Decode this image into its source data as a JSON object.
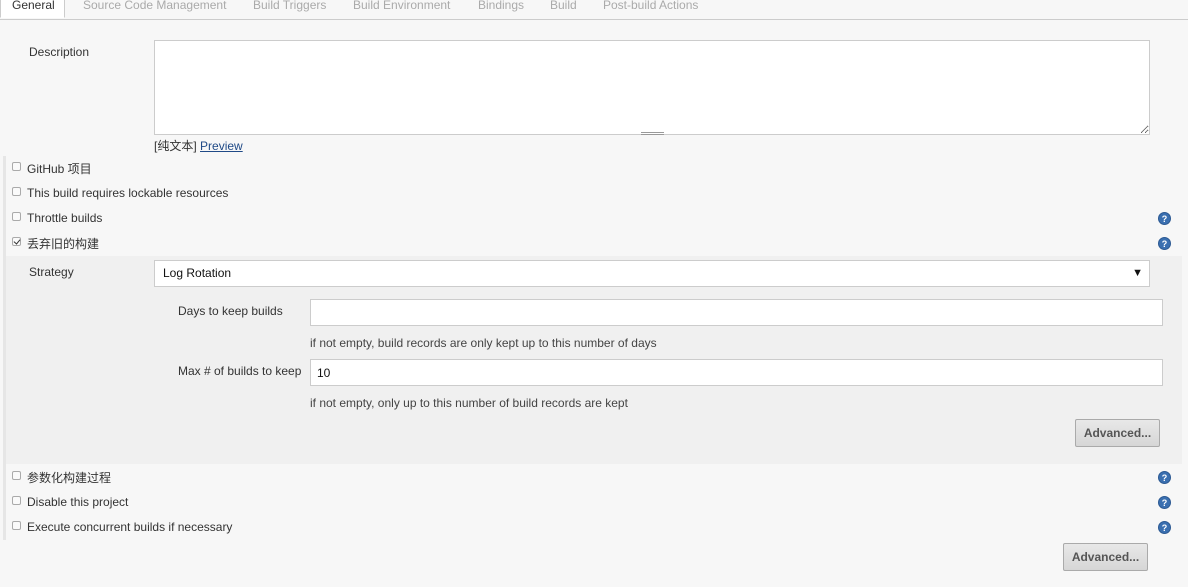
{
  "tabs": [
    {
      "label": "General"
    },
    {
      "label": "Source Code Management"
    },
    {
      "label": "Build Triggers"
    },
    {
      "label": "Build Environment"
    },
    {
      "label": "Bindings"
    },
    {
      "label": "Build"
    },
    {
      "label": "Post-build Actions"
    }
  ],
  "description": {
    "label": "Description",
    "value": "",
    "format_label": "[纯文本]",
    "preview_link": "Preview"
  },
  "options_top": [
    {
      "label": "GitHub 项目",
      "checked": false
    },
    {
      "label": "This build requires lockable resources",
      "checked": false
    },
    {
      "label": "Throttle builds",
      "checked": false,
      "help": true
    },
    {
      "label": "丢弃旧的构建",
      "checked": true,
      "help": true
    }
  ],
  "strategy": {
    "label": "Strategy",
    "selected": "Log Rotation",
    "days_label": "Days to keep builds",
    "days_value": "",
    "days_hint": "if not empty, build records are only kept up to this number of days",
    "max_label": "Max # of builds to keep",
    "max_value": "10",
    "max_hint": "if not empty, only up to this number of build records are kept",
    "advanced_label": "Advanced..."
  },
  "options_bottom": [
    {
      "label": "参数化构建过程",
      "checked": false,
      "help": true
    },
    {
      "label": "Disable this project",
      "checked": false,
      "help": true
    },
    {
      "label": "Execute concurrent builds if necessary",
      "checked": false,
      "help": true
    }
  ],
  "advanced_button": "Advanced...",
  "help_glyph": "?",
  "select_arrow": "▼",
  "icons": {
    "help": "help-icon",
    "dropdown": "chevron-down-icon"
  }
}
